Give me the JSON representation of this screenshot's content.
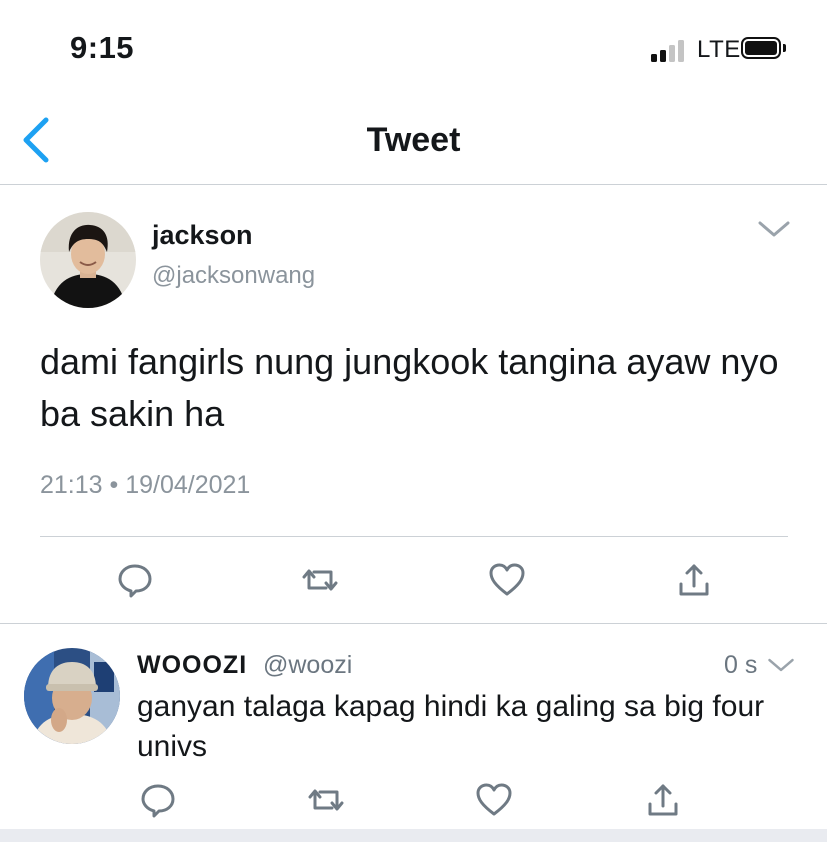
{
  "status_bar": {
    "time": "9:15",
    "network": "LTE"
  },
  "nav": {
    "title": "Tweet",
    "back_icon": "chevron-left-icon"
  },
  "tweet": {
    "name": "jackson",
    "handle": "@jacksonwang",
    "text": "dami fangirls nung jungkook tangina ayaw nyo ba sakin ha",
    "timestamp": "21:13 • 19/04/2021",
    "actions": [
      "reply-icon",
      "retweet-icon",
      "like-icon",
      "share-icon"
    ]
  },
  "reply": {
    "name": "WOOOZI",
    "handle": "@woozi",
    "time": "0 s",
    "text": "ganyan talaga kapag hindi ka galing sa big four univs",
    "actions": [
      "reply-icon",
      "retweet-icon",
      "like-icon",
      "share-icon"
    ]
  },
  "colors": {
    "accent": "#1da1f2",
    "secondary_text": "#8b949c",
    "divider": "#ccd1d6"
  }
}
